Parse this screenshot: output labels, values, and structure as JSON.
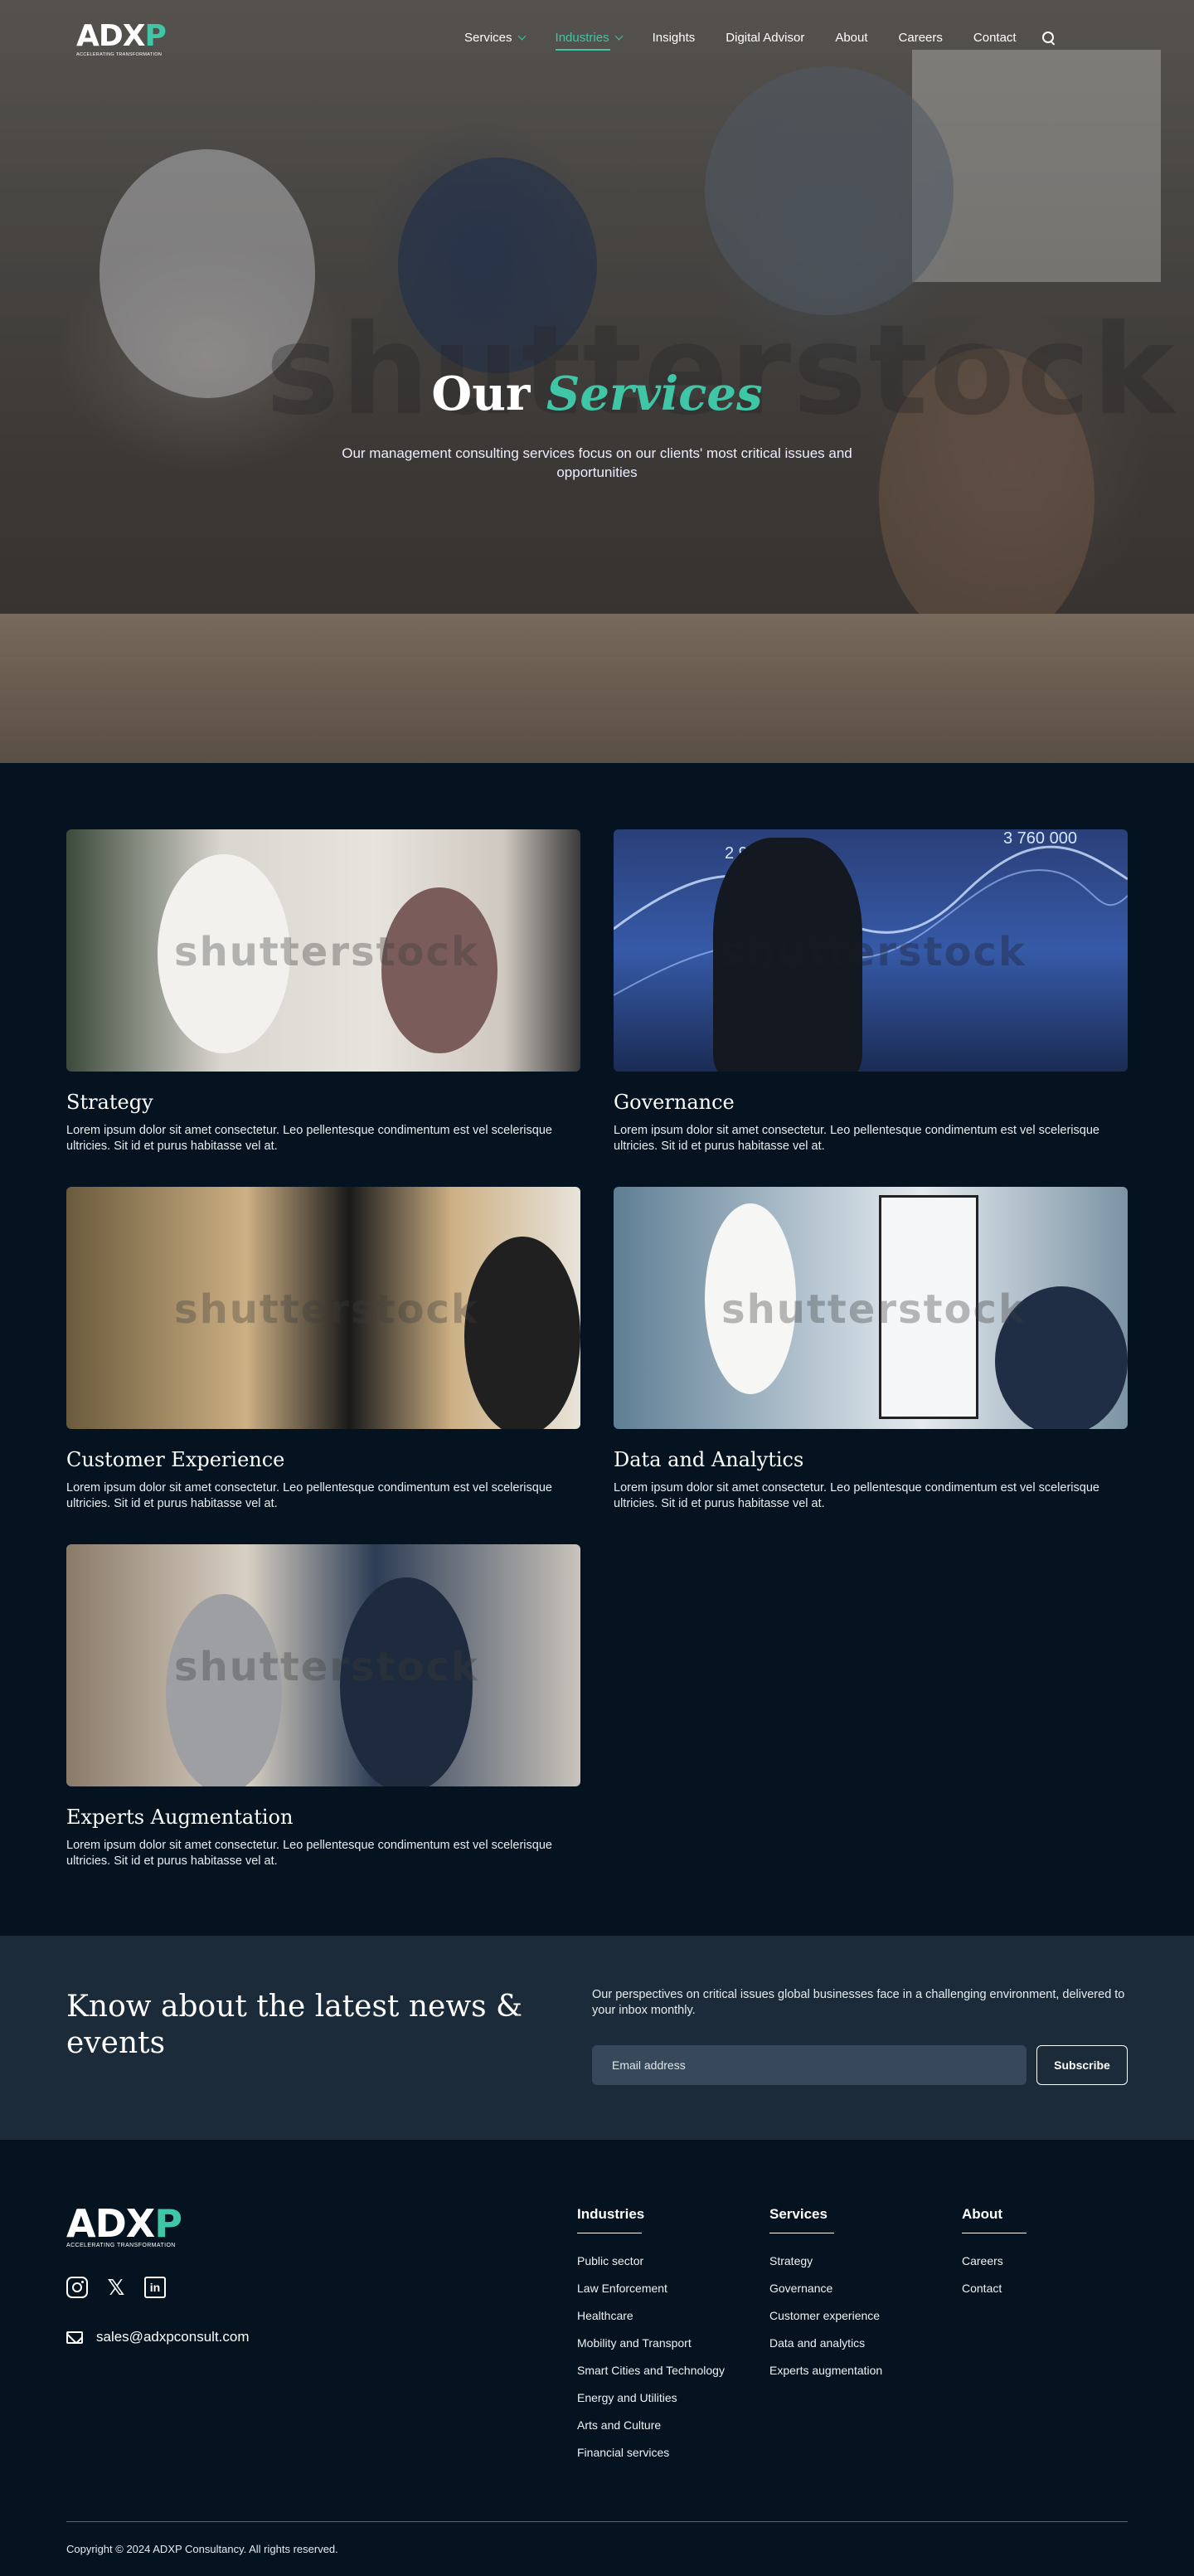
{
  "brand": {
    "logo_text_a": "ADX",
    "logo_text_b": "P",
    "tagline": "ACCELERATING TRANSFORMATION"
  },
  "nav": {
    "items": [
      {
        "label": "Services",
        "dropdown": true,
        "active": false
      },
      {
        "label": "Industries",
        "dropdown": true,
        "active": true
      },
      {
        "label": "Insights",
        "dropdown": false,
        "active": false
      },
      {
        "label": "Digital Advisor",
        "dropdown": false,
        "active": false
      },
      {
        "label": "About",
        "dropdown": false,
        "active": false
      },
      {
        "label": "Careers",
        "dropdown": false,
        "active": false
      },
      {
        "label": "Contact",
        "dropdown": false,
        "active": false
      }
    ],
    "search_icon": "search-icon"
  },
  "hero": {
    "title_plain": "Our",
    "title_accent": "Services",
    "subtitle": "Our management consulting services focus on our clients' most critical issues and opportunities",
    "watermark": "shutterstock"
  },
  "services": [
    {
      "title": "Strategy",
      "text": "Lorem ipsum dolor sit amet consectetur. Leo pellentesque condimentum est vel scelerisque ultricies. Sit id et purus habitasse vel at.",
      "watermark": "shutterstock"
    },
    {
      "title": "Governance",
      "text": "Lorem ipsum dolor sit amet consectetur. Leo pellentesque condimentum est vel scelerisque ultricies. Sit id et purus habitasse vel at.",
      "watermark": "shutterstock",
      "chart_labels": [
        "2 980 00",
        "3 760 000"
      ]
    },
    {
      "title": "Customer Experience",
      "text": "Lorem ipsum dolor sit amet consectetur. Leo pellentesque condimentum est vel scelerisque ultricies. Sit id et purus habitasse vel at.",
      "watermark": "shutterstock"
    },
    {
      "title": "Data and Analytics",
      "text": "Lorem ipsum dolor sit amet consectetur. Leo pellentesque condimentum est vel scelerisque ultricies. Sit id et purus habitasse vel at.",
      "watermark": "shutterstock"
    },
    {
      "title": "Experts Augmentation",
      "text": "Lorem ipsum dolor sit amet consectetur. Leo pellentesque condimentum est vel scelerisque ultricies. Sit id et purus habitasse vel at.",
      "watermark": "shutterstock"
    }
  ],
  "newsletter": {
    "heading": "Know about the latest news & events",
    "description": "Our perspectives on critical issues global businesses face in a challenging environment, delivered to your inbox monthly.",
    "email_placeholder": "Email address",
    "subscribe_label": "Subscribe"
  },
  "footer": {
    "email": "sales@adxpconsult.com",
    "socials": [
      "instagram-icon",
      "x-icon",
      "linkedin-icon"
    ],
    "columns": [
      {
        "heading": "Industries",
        "links": [
          "Public sector",
          "Law Enforcement",
          "Healthcare",
          "Mobility and Transport",
          "Smart Cities and Technology",
          "Energy and Utilities",
          "Arts and Culture",
          "Financial services"
        ]
      },
      {
        "heading": "Services",
        "links": [
          "Strategy",
          "Governance",
          "Customer experience",
          "Data and analytics",
          "Experts augmentation"
        ]
      },
      {
        "heading": "About",
        "links": [
          "Careers",
          "Contact"
        ]
      }
    ],
    "copyright": "Copyright © 2024 ADXP Consultancy. All rights reserved."
  },
  "colors": {
    "accent": "#3fc6a6",
    "background": "#04131f",
    "newsletter_bg": "#1b2b39",
    "input_bg": "#37485a"
  }
}
